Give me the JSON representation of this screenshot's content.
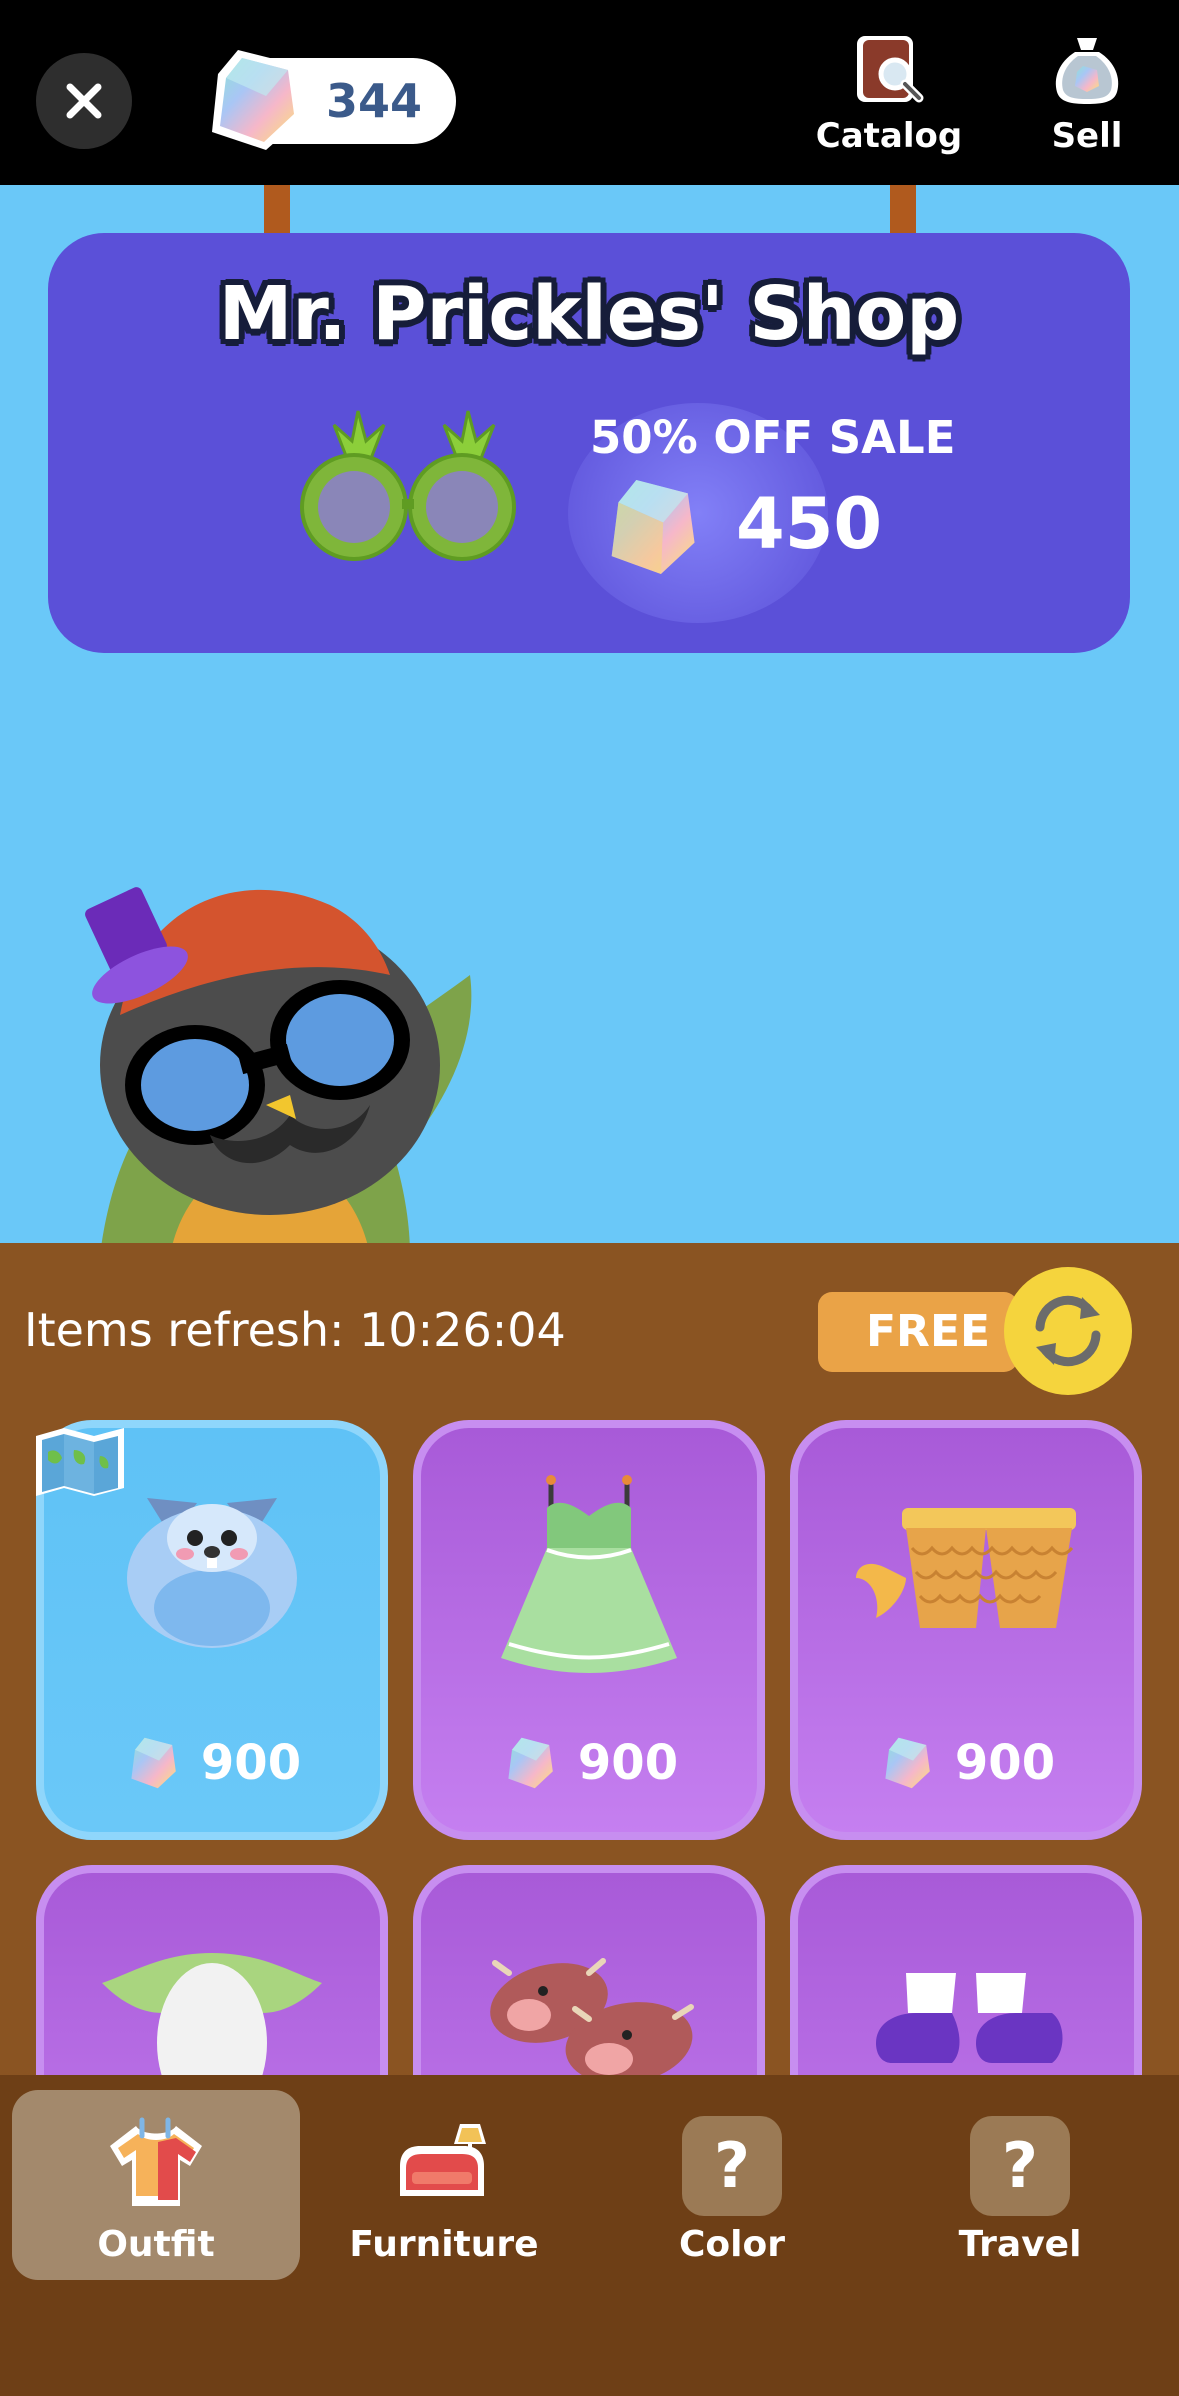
{
  "header": {
    "gem_count": "344",
    "catalog_label": "Catalog",
    "sell_label": "Sell"
  },
  "shop": {
    "title": "Mr. Prickles' Shop",
    "sale_label": "50% OFF SALE",
    "sale_price": "450",
    "featured_item_icon": "pineapple-glasses-icon"
  },
  "refresh": {
    "text": "Items refresh: 10:26:04",
    "free_label": "FREE"
  },
  "items": [
    {
      "name": "hedgehog-hood",
      "price": "900",
      "selected": true
    },
    {
      "name": "green-dress",
      "price": "900",
      "selected": false
    },
    {
      "name": "scale-shorts",
      "price": "900",
      "selected": false
    },
    {
      "name": "shark-suit",
      "price": "",
      "selected": false
    },
    {
      "name": "cow-slippers",
      "price": "",
      "selected": false
    },
    {
      "name": "purple-shoes",
      "price": "",
      "selected": false
    }
  ],
  "nav": {
    "tabs": [
      {
        "label": "Outfit",
        "icon": "shirt-icon",
        "active": true
      },
      {
        "label": "Furniture",
        "icon": "sofa-icon",
        "active": false
      },
      {
        "label": "Color",
        "icon": "question-icon",
        "active": false
      },
      {
        "label": "Travel",
        "icon": "question-icon",
        "active": false
      }
    ],
    "locked_glyph": "?"
  },
  "colors": {
    "sky": "#6ac8f8",
    "sign": "#5b50d8",
    "floor": "#8a5422",
    "nav": "#6e3f16",
    "card_purple": "#b46be2",
    "card_blue": "#5fc2f6"
  }
}
